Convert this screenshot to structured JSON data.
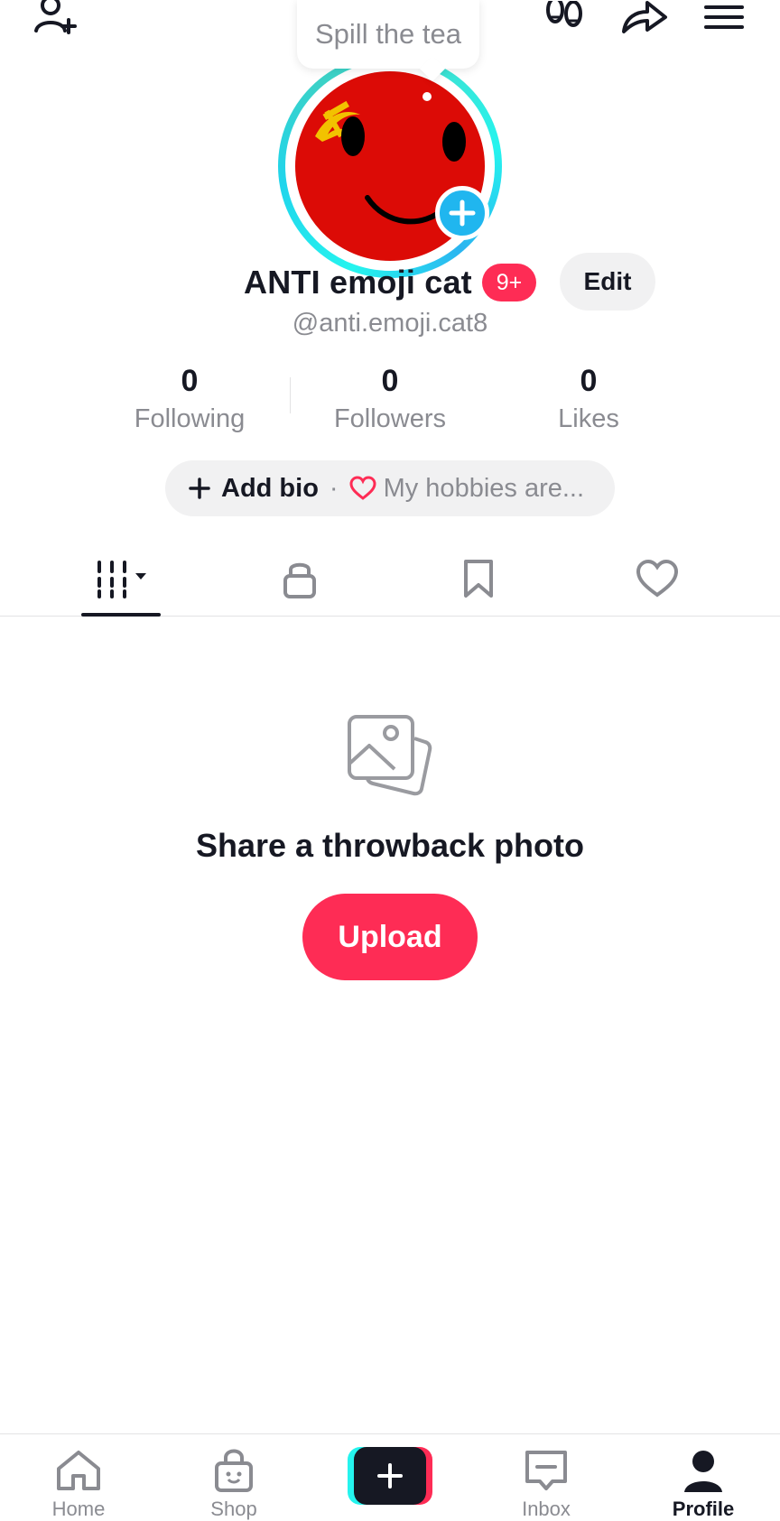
{
  "top_bar": {
    "tooltip_text": "Spill the tea",
    "icons": [
      "add-friend-icon",
      "footprints-icon",
      "share-icon",
      "menu-icon"
    ]
  },
  "profile": {
    "display_name": "ANTI emoji cat",
    "notification_badge": "9+",
    "edit_label": "Edit",
    "handle": "@anti.emoji.cat8",
    "avatar_description_icon": "red-emoji-face-with-hammer-and-sickle"
  },
  "stats": [
    {
      "value": "0",
      "label": "Following"
    },
    {
      "value": "0",
      "label": "Followers"
    },
    {
      "value": "0",
      "label": "Likes"
    }
  ],
  "bio": {
    "add_label": "Add bio",
    "separator": "·",
    "hint": "My hobbies are..."
  },
  "tabs": [
    {
      "icon": "videos-grid-icon",
      "active": true
    },
    {
      "icon": "lock-icon",
      "active": false
    },
    {
      "icon": "bookmark-icon",
      "active": false
    },
    {
      "icon": "heart-icon",
      "active": false
    }
  ],
  "empty_state": {
    "icon": "photos-icon",
    "title": "Share a throwback photo",
    "button_label": "Upload"
  },
  "bottom_nav": {
    "items": [
      {
        "label": "Home",
        "icon": "home-icon"
      },
      {
        "label": "Shop",
        "icon": "shop-icon"
      },
      {
        "label": "",
        "icon": "create-plus-icon"
      },
      {
        "label": "Inbox",
        "icon": "inbox-icon"
      },
      {
        "label": "Profile",
        "icon": "profile-icon",
        "active": true
      }
    ]
  },
  "colors": {
    "accent": "#fe2c55",
    "text_primary": "#161823",
    "text_secondary": "#8a8b91",
    "avatar_ring": "#25f4ee",
    "avatar_plus": "#20b6ef",
    "avatar_face": "#dc0b06"
  }
}
